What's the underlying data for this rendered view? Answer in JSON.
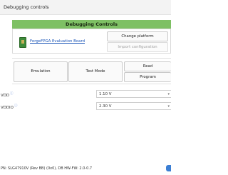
{
  "window": {
    "title": "Debugging controls"
  },
  "header": {
    "title": "Debugging Controls"
  },
  "board": {
    "link_text": "ForgeFPGA Evaluation Board",
    "icon": "board-icon"
  },
  "platform": {
    "change_label": "Change platform",
    "import_label": "Import configuration"
  },
  "modes": {
    "emulation_label": "Emulation",
    "test_mode_label": "Test Mode",
    "read_label": "Read",
    "program_label": "Program"
  },
  "voltages": [
    {
      "label": "VDD",
      "value": "1.10 V",
      "info_icon": "info-icon"
    },
    {
      "label": "VDDIO",
      "value": "2.30 V",
      "info_icon": "info-icon"
    }
  ],
  "footer": {
    "text": "PN: SLG47910V (Rev BB) (0x0), DB HW-FW: 2.0-0.7"
  },
  "colors": {
    "header_green": "#7ec064",
    "link_blue": "#1a55b8",
    "accent_blue": "#3c7fd4"
  }
}
